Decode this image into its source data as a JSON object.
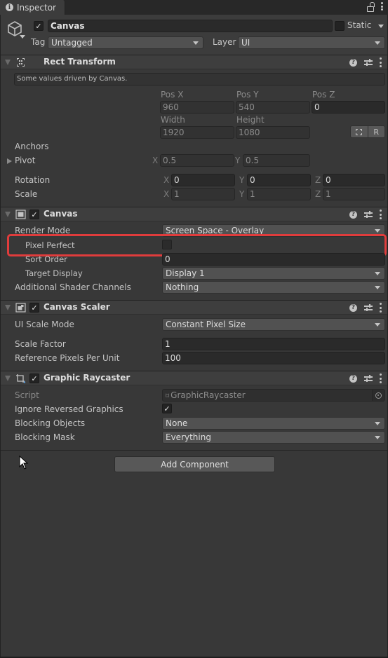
{
  "tab": {
    "title": "Inspector",
    "icon": "info-icon"
  },
  "gameobject": {
    "active": true,
    "name": "Canvas",
    "static_label": "Static",
    "static_checked": false,
    "tag_label": "Tag",
    "tag_value": "Untagged",
    "layer_label": "Layer",
    "layer_value": "UI"
  },
  "rect_transform": {
    "title": "Rect Transform",
    "info": "Some values driven by Canvas.",
    "pos_x_label": "Pos X",
    "pos_y_label": "Pos Y",
    "pos_z_label": "Pos Z",
    "pos_x": "960",
    "pos_y": "540",
    "pos_z": "0",
    "width_label": "Width",
    "height_label": "Height",
    "width": "1920",
    "height": "1080",
    "raw_button": "R",
    "anchors_label": "Anchors",
    "pivot_label": "Pivot",
    "pivot_x": "0.5",
    "pivot_y": "0.5",
    "rotation_label": "Rotation",
    "rotation_x": "0",
    "rotation_y": "0",
    "rotation_z": "0",
    "scale_label": "Scale",
    "scale_x": "1",
    "scale_y": "1",
    "scale_z": "1",
    "axis_x": "X",
    "axis_y": "Y",
    "axis_z": "Z"
  },
  "canvas": {
    "title": "Canvas",
    "enabled": true,
    "render_mode_label": "Render Mode",
    "render_mode_value": "Screen Space - Overlay",
    "pixel_perfect_label": "Pixel Perfect",
    "pixel_perfect": false,
    "sort_order_label": "Sort Order",
    "sort_order": "0",
    "target_display_label": "Target Display",
    "target_display": "Display 1",
    "shader_channels_label": "Additional Shader Channels",
    "shader_channels": "Nothing",
    "highlight_color": "#e03c3c"
  },
  "canvas_scaler": {
    "title": "Canvas Scaler",
    "enabled": true,
    "ui_scale_mode_label": "UI Scale Mode",
    "ui_scale_mode": "Constant Pixel Size",
    "scale_factor_label": "Scale Factor",
    "scale_factor": "1",
    "ref_ppu_label": "Reference Pixels Per Unit",
    "ref_ppu": "100"
  },
  "graphic_raycaster": {
    "title": "Graphic Raycaster",
    "enabled": true,
    "script_label": "Script",
    "script_value": "GraphicRaycaster",
    "ignore_reversed_label": "Ignore Reversed Graphics",
    "ignore_reversed": true,
    "blocking_objects_label": "Blocking Objects",
    "blocking_objects": "None",
    "blocking_mask_label": "Blocking Mask",
    "blocking_mask": "Everything"
  },
  "add_component_label": "Add Component",
  "icons": {
    "help": "?",
    "check": "✓"
  }
}
